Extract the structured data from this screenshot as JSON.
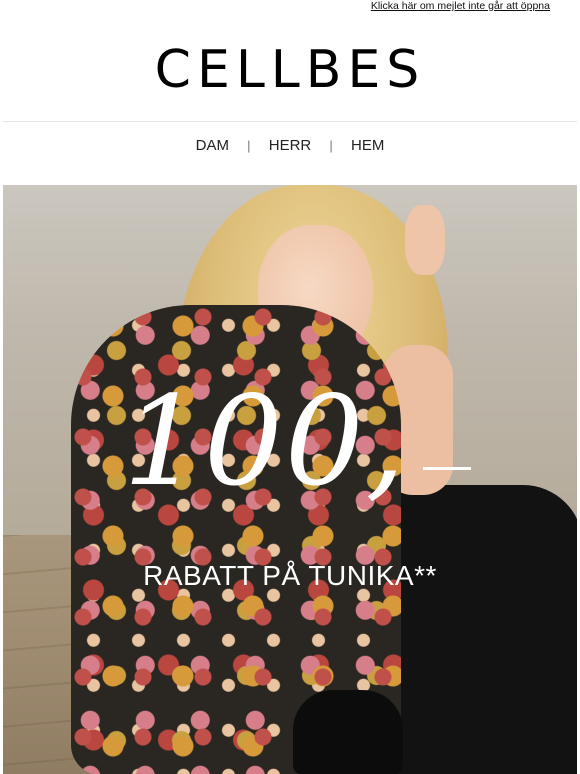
{
  "header": {
    "view_online_link": "Klicka här om mejlet inte går att öppna",
    "logo": "CELLBES"
  },
  "nav": {
    "items": [
      "DAM",
      "HERR",
      "HEM"
    ],
    "separator": "|"
  },
  "hero": {
    "amount": "100,",
    "promo_text": "RABATT PÅ TUNIKA**"
  }
}
